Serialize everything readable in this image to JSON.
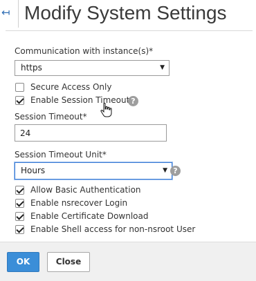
{
  "header": {
    "title": "Modify System Settings",
    "back_icon": "back-arrow-icon"
  },
  "form": {
    "communication": {
      "label": "Communication with instance(s)*",
      "value": "https"
    },
    "secure_access_only": {
      "label": "Secure Access Only",
      "checked": false
    },
    "enable_session_timeout": {
      "label": "Enable Session Timeout",
      "checked": true
    },
    "session_timeout": {
      "label": "Session Timeout*",
      "value": "24"
    },
    "session_timeout_unit": {
      "label": "Session Timeout Unit*",
      "value": "Hours"
    },
    "options": [
      {
        "label": "Allow Basic Authentication",
        "checked": true
      },
      {
        "label": "Enable nsrecover Login",
        "checked": true
      },
      {
        "label": "Enable Certificate Download",
        "checked": true
      },
      {
        "label": "Enable Shell access for non-nsroot User",
        "checked": true
      }
    ],
    "help_glyph": "?"
  },
  "footer": {
    "ok_label": "OK",
    "close_label": "Close"
  },
  "colors": {
    "primary_button": "#3b8ed8",
    "focus_border": "#3a7bd5",
    "back_arrow": "#2f6db4"
  }
}
